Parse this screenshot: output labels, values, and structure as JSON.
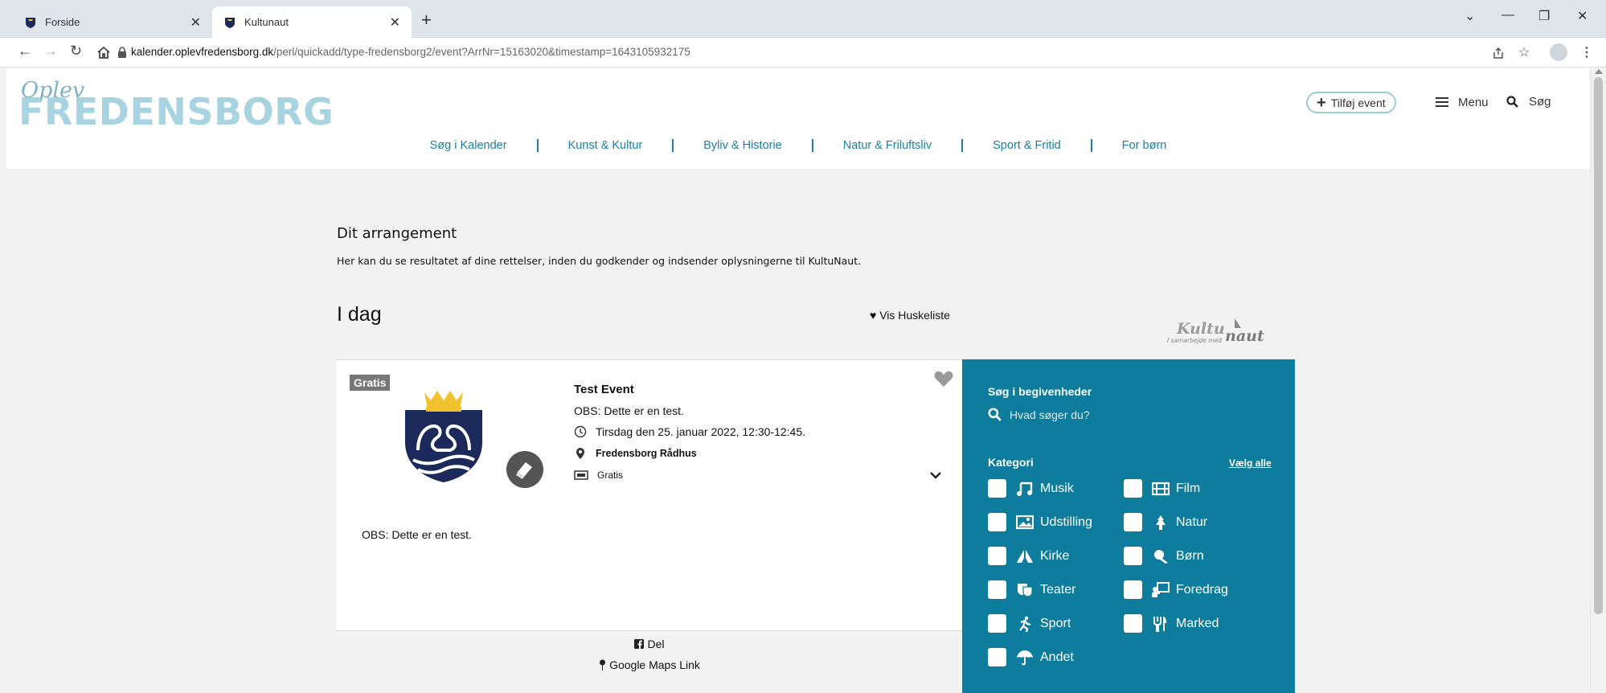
{
  "browser": {
    "tabs": [
      {
        "title": "Forside",
        "active": false
      },
      {
        "title": "Kultunaut",
        "active": true
      }
    ],
    "url_domain": "kalender.oplevfredensborg.dk",
    "url_path": "/perl/quickadd/type-fredensborg2/event?ArrNr=15163020&timestamp=1643105932175",
    "icons": [
      "back-icon",
      "forward-icon",
      "reload-icon",
      "home-icon",
      "lock-icon",
      "share-icon",
      "star-icon",
      "profile-icon",
      "kebab-menu-icon"
    ]
  },
  "header": {
    "logo_small": "Oplev",
    "logo_big": "FREDENSBORG",
    "add_event": "Tilføj event",
    "menu": "Menu",
    "search": "Søg",
    "nav": [
      "Søg i Kalender",
      "Kunst & Kultur",
      "Byliv & Historie",
      "Natur & Friluftsliv",
      "Sport & Fritid",
      "For børn"
    ]
  },
  "intro": {
    "title": "Dit arrangement",
    "text": "Her kan du se resultatet af dine rettelser, inden du godkender og indsender oplysningerne til KultuNaut."
  },
  "list": {
    "heading": "I dag",
    "watchlist": "Vis Huskeliste",
    "partner_logo": "Kultunaut",
    "partner_tagline": "I samarbejde med"
  },
  "event": {
    "badge": "Gratis",
    "title": "Test Event",
    "obs": "OBS: Dette er en test.",
    "date": "Tirsdag den 25. januar 2022, 12:30-12:45.",
    "place": "Fredensborg Rådhus",
    "price": "Gratis",
    "description": "OBS: Dette er en test.",
    "share": "Del",
    "maps": "Google Maps Link"
  },
  "sidebar": {
    "heading": "Søg i begivenheder",
    "search_placeholder": "Hvad søger du?",
    "category_label": "Kategori",
    "select_all": "Vælg alle",
    "categories": [
      "Musik",
      "Film",
      "Udstilling",
      "Natur",
      "Kirke",
      "Børn",
      "Teater",
      "Foredrag",
      "Sport",
      "Marked",
      "Andet"
    ]
  },
  "colors": {
    "accent": "#0e7c9c",
    "link": "#1d7fa3",
    "logo": "#a8d4e1",
    "crest_navy": "#1b2a5b",
    "crest_gold": "#f2c12e"
  }
}
